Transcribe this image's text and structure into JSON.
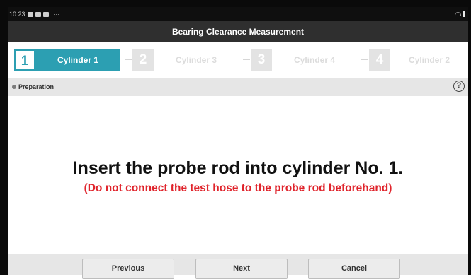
{
  "statusbar": {
    "time": "10:23",
    "more": "···"
  },
  "window": {
    "title": "Bearing Clearance Measurement"
  },
  "steps": [
    {
      "num": "1",
      "label": "Cylinder 1",
      "state": "active"
    },
    {
      "num": "2",
      "label": "Cylinder 3",
      "state": "inactive"
    },
    {
      "num": "3",
      "label": "Cylinder 4",
      "state": "inactive"
    },
    {
      "num": "4",
      "label": "Cylinder 2",
      "state": "inactive"
    }
  ],
  "prep": {
    "label": "Preparation",
    "help_symbol": "?"
  },
  "content": {
    "instruction": "Insert the probe rod into cylinder No. 1.",
    "warning": "(Do not connect the test hose to the probe rod beforehand)"
  },
  "buttons": {
    "previous": "Previous",
    "next": "Next",
    "cancel": "Cancel"
  },
  "colors": {
    "accent": "#2c9fb2",
    "warning": "#e0242c",
    "titlebar": "#2f2f2f"
  },
  "icons": [
    "image-icon",
    "calendar-icon",
    "mail-icon",
    "wifi-icon",
    "battery-icon",
    "help-icon"
  ]
}
